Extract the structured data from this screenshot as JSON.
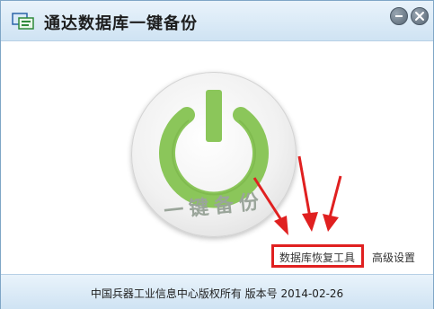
{
  "window": {
    "title": "通达数据库一键备份"
  },
  "titlebar": {
    "minimize_icon": "minimize-icon",
    "close_icon": "close-icon"
  },
  "main": {
    "power_button": {
      "label": "一键备份",
      "icon": "power-icon"
    },
    "links": {
      "restore_tool": "数据库恢复工具",
      "advanced_settings": "高级设置"
    }
  },
  "footer": {
    "text": "中国兵器工业信息中心版权所有 版本号 2014-02-26"
  },
  "colors": {
    "power_green": "#7fbb4d",
    "highlight_red": "#e02020"
  }
}
